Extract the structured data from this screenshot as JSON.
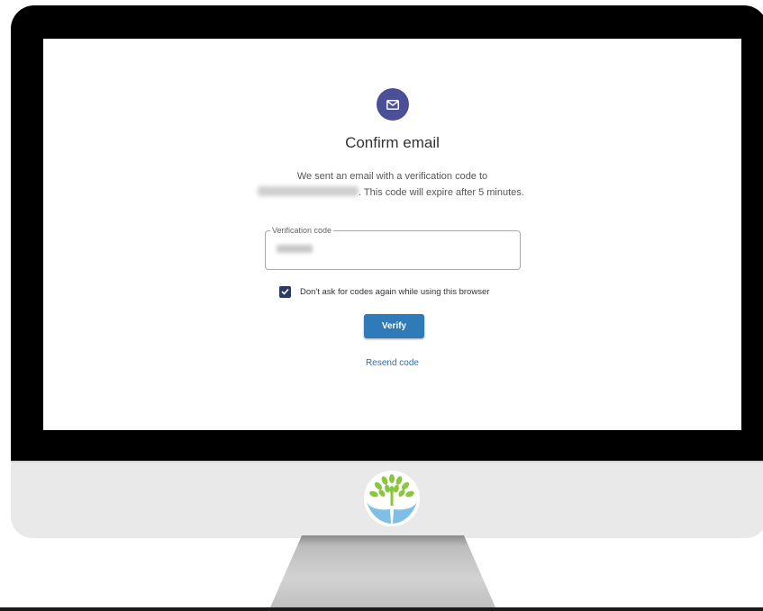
{
  "dialog": {
    "title": "Confirm email",
    "description_line1": "We sent an email with a verification code to",
    "description_line2_suffix": ". This code will expire after 5 minutes.",
    "email_redacted": true
  },
  "verification_field": {
    "label": "Verification code",
    "value_redacted": true
  },
  "remember_checkbox": {
    "checked": true,
    "label": "Don't ask for codes again while using this browser"
  },
  "verify_button": {
    "label": "Verify"
  },
  "resend_link": {
    "label": "Resend code"
  },
  "colors": {
    "icon_circle": "#4b4f95",
    "button": "#2f7ab8",
    "link": "#2f6fad",
    "checkbox": "#2c3a63",
    "logo_leaves": "#8cc63f",
    "logo_hands": "#7fbfe6"
  },
  "icons": {
    "header": "envelope-icon",
    "checkbox": "checkmark-icon",
    "brand": "tree-hands-logo"
  }
}
